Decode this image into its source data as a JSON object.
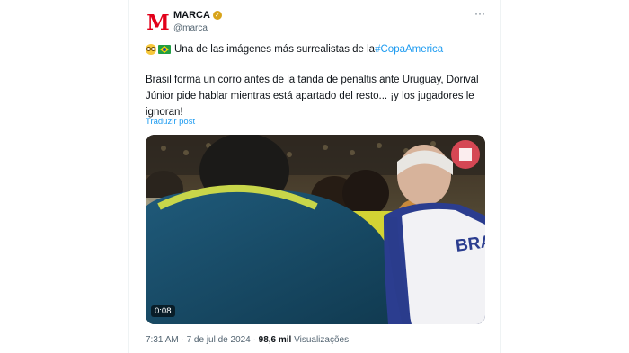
{
  "account": {
    "avatar_letter": "M",
    "name": "MARCA",
    "handle": "@marca"
  },
  "tweet": {
    "headline_text": "Una de las imágenes más surrealistas de la ",
    "hashtag": "#CopaAmerica",
    "body": "Brasil forma un corro antes de la tanda de penaltis ante Uruguay, Dorival Júnior pide hablar mientras está apartado del resto... ¡y los jugadores le ignoran!",
    "translate_label": "Traduzir post"
  },
  "media": {
    "duration": "0:08",
    "jersey_text": "BRA"
  },
  "meta": {
    "timestamp": "7:31 AM · 7 de jul de 2024 · ",
    "views_count": "98,6 mil",
    "views_label": " Visualizações"
  },
  "icons": [
    "verified-badge-icon",
    "more-options-icon",
    "flushed-face-emoji",
    "brazil-flag-emoji"
  ],
  "colors": {
    "accent": "#1d9bf0",
    "brand": "#e2001a",
    "verified": "#d8a31a"
  }
}
